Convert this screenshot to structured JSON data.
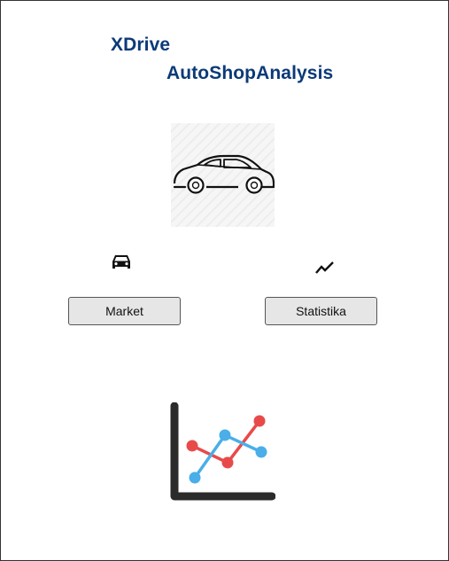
{
  "app": {
    "title_line1": "XDrive",
    "title_line2": "AutoShopAnalysis"
  },
  "colors": {
    "title": "#0b3a78",
    "button_bg": "#e6e6e6",
    "chart_red": "#e84a4a",
    "chart_blue": "#4aaee8",
    "chart_axis": "#2b2b2b"
  },
  "icons": {
    "hero": "car-outline-icon",
    "market": "car-icon",
    "statistics": "trending-up-icon",
    "bottom": "line-chart-icon"
  },
  "buttons": {
    "market_label": "Market",
    "statistics_label": "Statistika"
  }
}
